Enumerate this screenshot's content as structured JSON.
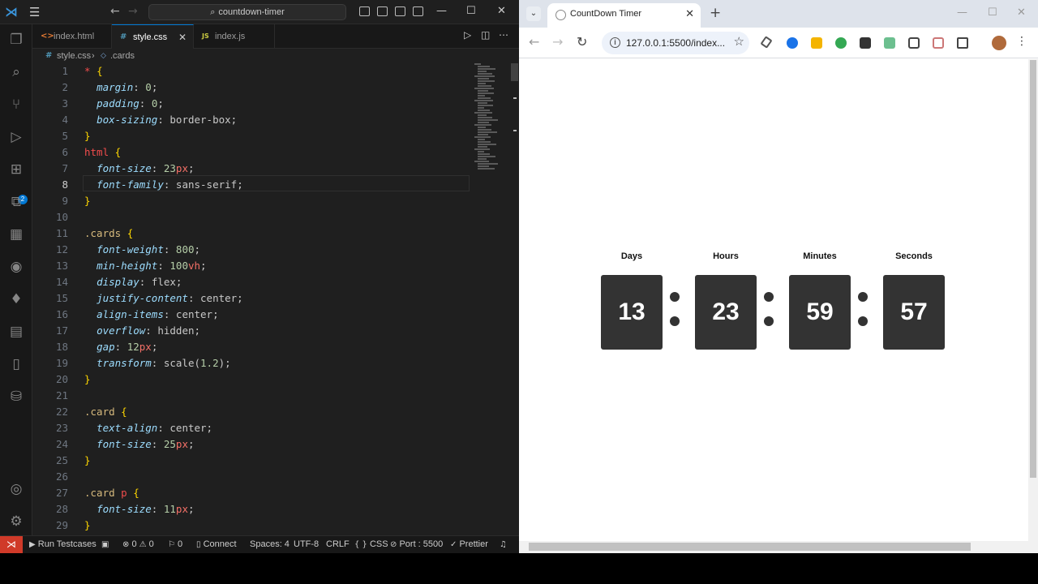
{
  "vscode": {
    "search": "countdown-timer",
    "tabs": [
      {
        "label": "index.html",
        "icon": "<>"
      },
      {
        "label": "style.css",
        "icon": "#"
      },
      {
        "label": "index.js",
        "icon": "JS"
      }
    ],
    "breadcrumb": {
      "file": "style.css",
      "symbol": ".cards"
    },
    "code": [
      {
        "n": "1",
        "t": [
          [
            "t-tag",
            "*"
          ],
          [
            "t-pun",
            " "
          ],
          [
            "t-brace",
            "{"
          ]
        ]
      },
      {
        "n": "2",
        "t": [
          [
            "t-pun",
            "  "
          ],
          [
            "t-prop",
            "margin"
          ],
          [
            "t-pun",
            ": "
          ],
          [
            "t-num",
            "0"
          ],
          [
            "t-pun",
            ";"
          ]
        ]
      },
      {
        "n": "3",
        "t": [
          [
            "t-pun",
            "  "
          ],
          [
            "t-prop",
            "padding"
          ],
          [
            "t-pun",
            ": "
          ],
          [
            "t-num",
            "0"
          ],
          [
            "t-pun",
            ";"
          ]
        ]
      },
      {
        "n": "4",
        "t": [
          [
            "t-pun",
            "  "
          ],
          [
            "t-prop",
            "box-sizing"
          ],
          [
            "t-pun",
            ": "
          ],
          [
            "t-val2",
            "border-box"
          ],
          [
            "t-pun",
            ";"
          ]
        ]
      },
      {
        "n": "5",
        "t": [
          [
            "t-brace",
            "}"
          ]
        ]
      },
      {
        "n": "6",
        "t": [
          [
            "t-tag",
            "html"
          ],
          [
            "t-pun",
            " "
          ],
          [
            "t-brace",
            "{"
          ]
        ]
      },
      {
        "n": "7",
        "t": [
          [
            "t-pun",
            "  "
          ],
          [
            "t-prop",
            "font-size"
          ],
          [
            "t-pun",
            ": "
          ],
          [
            "t-num",
            "23"
          ],
          [
            "t-unit",
            "px"
          ],
          [
            "t-pun",
            ";"
          ]
        ]
      },
      {
        "n": "8",
        "t": [
          [
            "t-pun",
            "  "
          ],
          [
            "t-prop",
            "font-family"
          ],
          [
            "t-pun",
            ": "
          ],
          [
            "t-val2",
            "sans-serif"
          ],
          [
            "t-pun",
            ";"
          ]
        ]
      },
      {
        "n": "9",
        "t": [
          [
            "t-brace",
            "}"
          ]
        ]
      },
      {
        "n": "10",
        "t": []
      },
      {
        "n": "11",
        "t": [
          [
            "t-sel",
            ".cards"
          ],
          [
            "t-pun",
            " "
          ],
          [
            "t-brace",
            "{"
          ]
        ]
      },
      {
        "n": "12",
        "t": [
          [
            "t-pun",
            "  "
          ],
          [
            "t-prop",
            "font-weight"
          ],
          [
            "t-pun",
            ": "
          ],
          [
            "t-num",
            "800"
          ],
          [
            "t-pun",
            ";"
          ]
        ]
      },
      {
        "n": "13",
        "t": [
          [
            "t-pun",
            "  "
          ],
          [
            "t-prop",
            "min-height"
          ],
          [
            "t-pun",
            ": "
          ],
          [
            "t-num",
            "100"
          ],
          [
            "t-unit",
            "vh"
          ],
          [
            "t-pun",
            ";"
          ]
        ]
      },
      {
        "n": "14",
        "t": [
          [
            "t-pun",
            "  "
          ],
          [
            "t-prop",
            "display"
          ],
          [
            "t-pun",
            ": "
          ],
          [
            "t-val2",
            "flex"
          ],
          [
            "t-pun",
            ";"
          ]
        ]
      },
      {
        "n": "15",
        "t": [
          [
            "t-pun",
            "  "
          ],
          [
            "t-prop",
            "justify-content"
          ],
          [
            "t-pun",
            ": "
          ],
          [
            "t-val2",
            "center"
          ],
          [
            "t-pun",
            ";"
          ]
        ]
      },
      {
        "n": "16",
        "t": [
          [
            "t-pun",
            "  "
          ],
          [
            "t-prop",
            "align-items"
          ],
          [
            "t-pun",
            ": "
          ],
          [
            "t-val2",
            "center"
          ],
          [
            "t-pun",
            ";"
          ]
        ]
      },
      {
        "n": "17",
        "t": [
          [
            "t-pun",
            "  "
          ],
          [
            "t-prop",
            "overflow"
          ],
          [
            "t-pun",
            ": "
          ],
          [
            "t-val2",
            "hidden"
          ],
          [
            "t-pun",
            ";"
          ]
        ]
      },
      {
        "n": "18",
        "t": [
          [
            "t-pun",
            "  "
          ],
          [
            "t-prop",
            "gap"
          ],
          [
            "t-pun",
            ": "
          ],
          [
            "t-num",
            "12"
          ],
          [
            "t-unit",
            "px"
          ],
          [
            "t-pun",
            ";"
          ]
        ]
      },
      {
        "n": "19",
        "t": [
          [
            "t-pun",
            "  "
          ],
          [
            "t-prop",
            "transform"
          ],
          [
            "t-pun",
            ": "
          ],
          [
            "t-val2",
            "scale("
          ],
          [
            "t-num",
            "1.2"
          ],
          [
            "t-val2",
            ")"
          ],
          [
            "t-pun",
            ";"
          ]
        ]
      },
      {
        "n": "20",
        "t": [
          [
            "t-brace",
            "}"
          ]
        ]
      },
      {
        "n": "21",
        "t": []
      },
      {
        "n": "22",
        "t": [
          [
            "t-sel",
            ".card"
          ],
          [
            "t-pun",
            " "
          ],
          [
            "t-brace",
            "{"
          ]
        ]
      },
      {
        "n": "23",
        "t": [
          [
            "t-pun",
            "  "
          ],
          [
            "t-prop",
            "text-align"
          ],
          [
            "t-pun",
            ": "
          ],
          [
            "t-val2",
            "center"
          ],
          [
            "t-pun",
            ";"
          ]
        ]
      },
      {
        "n": "24",
        "t": [
          [
            "t-pun",
            "  "
          ],
          [
            "t-prop",
            "font-size"
          ],
          [
            "t-pun",
            ": "
          ],
          [
            "t-num",
            "25"
          ],
          [
            "t-unit",
            "px"
          ],
          [
            "t-pun",
            ";"
          ]
        ]
      },
      {
        "n": "25",
        "t": [
          [
            "t-brace",
            "}"
          ]
        ]
      },
      {
        "n": "26",
        "t": []
      },
      {
        "n": "27",
        "t": [
          [
            "t-sel",
            ".card"
          ],
          [
            "t-pun",
            " "
          ],
          [
            "t-tag",
            "p"
          ],
          [
            "t-pun",
            " "
          ],
          [
            "t-brace",
            "{"
          ]
        ]
      },
      {
        "n": "28",
        "t": [
          [
            "t-pun",
            "  "
          ],
          [
            "t-prop",
            "font-size"
          ],
          [
            "t-pun",
            ": "
          ],
          [
            "t-num",
            "11"
          ],
          [
            "t-unit",
            "px"
          ],
          [
            "t-pun",
            ";"
          ]
        ]
      },
      {
        "n": "29",
        "t": [
          [
            "t-brace",
            "}"
          ]
        ]
      }
    ],
    "status": {
      "run": "Run Testcases",
      "problems": "0",
      "warnings": "0",
      "ports": "0",
      "connect": "Connect",
      "spaces": "Spaces: 4",
      "encoding": "UTF-8",
      "eol": "CRLF",
      "lang": "CSS",
      "port": "Port : 5500",
      "prettier": "Prettier"
    },
    "activity_badge": "2"
  },
  "chrome": {
    "tab_title": "CountDown Timer",
    "url": "127.0.0.1:5500/index...",
    "countdown": [
      {
        "label": "Days",
        "value": "13"
      },
      {
        "label": "Hours",
        "value": "23"
      },
      {
        "label": "Minutes",
        "value": "59"
      },
      {
        "label": "Seconds",
        "value": "57"
      }
    ]
  },
  "colors": {
    "accent": "#0078d4",
    "remote": "#d03a29",
    "card": "#333333"
  }
}
